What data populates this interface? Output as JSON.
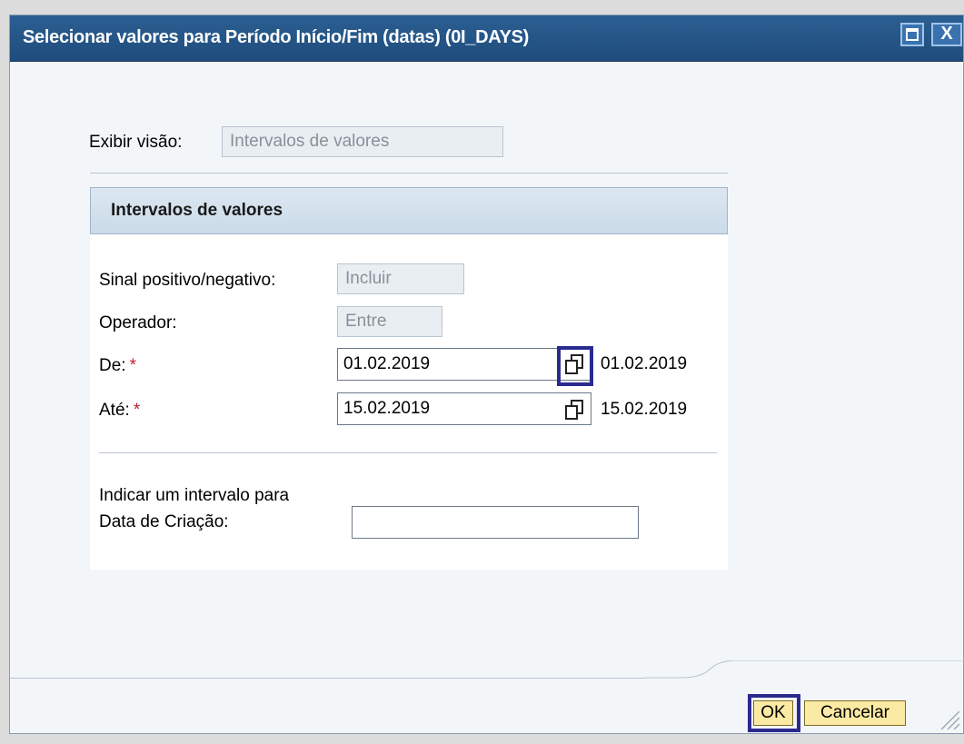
{
  "dialog": {
    "title": "Selecionar valores para Período Início/Fim (datas) (0I_DAYS)",
    "view_label": "Exibir visão:",
    "view_value": "Intervalos de valores",
    "panel_title": "Intervalos de valores",
    "sign_label": "Sinal positivo/negativo:",
    "sign_value": "Incluir",
    "operator_label": "Operador:",
    "operator_value": "Entre",
    "from_label": "De:",
    "from_value": "01.02.2019",
    "from_display": "01.02.2019",
    "to_label": "Até:",
    "to_value": "15.02.2019",
    "to_display": "15.02.2019",
    "required_mark": "*",
    "range_label_line1": "Indicar um intervalo para",
    "range_label_line2": "Data de Criação:",
    "range_value": "",
    "ok_label": "OK",
    "cancel_label": "Cancelar",
    "close_glyph": "X"
  },
  "icons": [
    "maximize-icon",
    "close-icon",
    "calendar-icon",
    "resize-grip-icon"
  ]
}
